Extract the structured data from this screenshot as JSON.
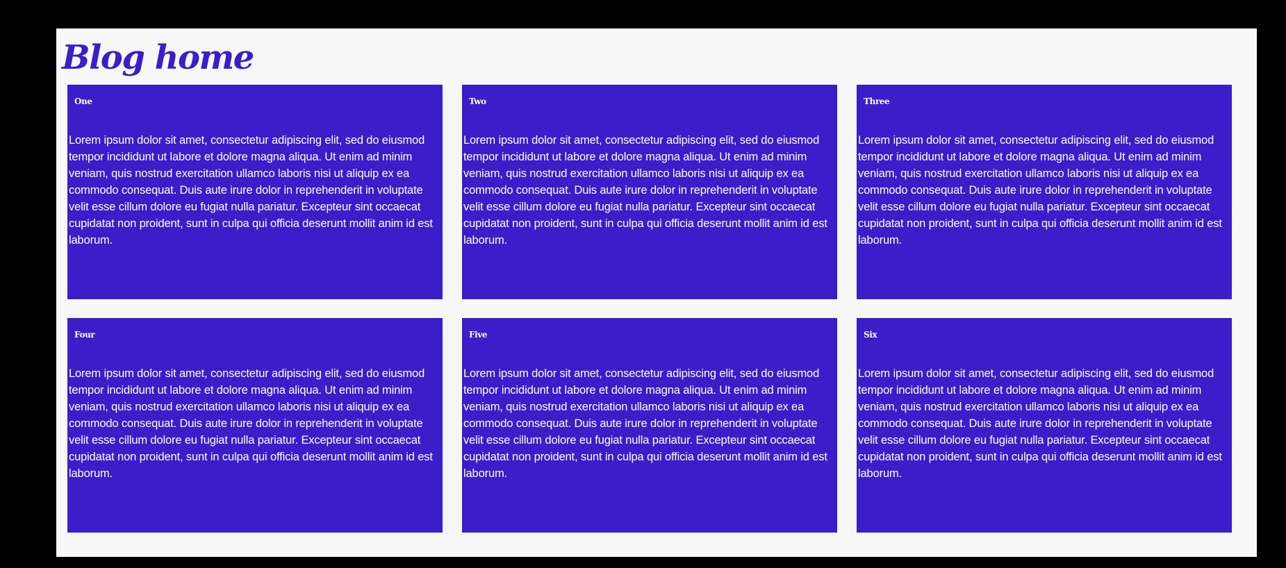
{
  "page": {
    "title": "Blog home"
  },
  "cards": [
    {
      "title": "One",
      "body": "Lorem ipsum dolor sit amet, consectetur adipiscing elit, sed do eiusmod tempor incididunt ut labore et dolore magna aliqua. Ut enim ad minim veniam, quis nostrud exercitation ullamco laboris nisi ut aliquip ex ea commodo consequat. Duis aute irure dolor in reprehenderit in voluptate velit esse cillum dolore eu fugiat nulla pariatur. Excepteur sint occaecat cupidatat non proident, sunt in culpa qui officia deserunt mollit anim id est laborum."
    },
    {
      "title": "Two",
      "body": "Lorem ipsum dolor sit amet, consectetur adipiscing elit, sed do eiusmod tempor incididunt ut labore et dolore magna aliqua. Ut enim ad minim veniam, quis nostrud exercitation ullamco laboris nisi ut aliquip ex ea commodo consequat. Duis aute irure dolor in reprehenderit in voluptate velit esse cillum dolore eu fugiat nulla pariatur. Excepteur sint occaecat cupidatat non proident, sunt in culpa qui officia deserunt mollit anim id est laborum."
    },
    {
      "title": "Three",
      "body": "Lorem ipsum dolor sit amet, consectetur adipiscing elit, sed do eiusmod tempor incididunt ut labore et dolore magna aliqua. Ut enim ad minim veniam, quis nostrud exercitation ullamco laboris nisi ut aliquip ex ea commodo consequat. Duis aute irure dolor in reprehenderit in voluptate velit esse cillum dolore eu fugiat nulla pariatur. Excepteur sint occaecat cupidatat non proident, sunt in culpa qui officia deserunt mollit anim id est laborum."
    },
    {
      "title": "Four",
      "body": "Lorem ipsum dolor sit amet, consectetur adipiscing elit, sed do eiusmod tempor incididunt ut labore et dolore magna aliqua. Ut enim ad minim veniam, quis nostrud exercitation ullamco laboris nisi ut aliquip ex ea commodo consequat. Duis aute irure dolor in reprehenderit in voluptate velit esse cillum dolore eu fugiat nulla pariatur. Excepteur sint occaecat cupidatat non proident, sunt in culpa qui officia deserunt mollit anim id est laborum."
    },
    {
      "title": "Five",
      "body": "Lorem ipsum dolor sit amet, consectetur adipiscing elit, sed do eiusmod tempor incididunt ut labore et dolore magna aliqua. Ut enim ad minim veniam, quis nostrud exercitation ullamco laboris nisi ut aliquip ex ea commodo consequat. Duis aute irure dolor in reprehenderit in voluptate velit esse cillum dolore eu fugiat nulla pariatur. Excepteur sint occaecat cupidatat non proident, sunt in culpa qui officia deserunt mollit anim id est laborum."
    },
    {
      "title": "Six",
      "body": "Lorem ipsum dolor sit amet, consectetur adipiscing elit, sed do eiusmod tempor incididunt ut labore et dolore magna aliqua. Ut enim ad minim veniam, quis nostrud exercitation ullamco laboris nisi ut aliquip ex ea commodo consequat. Duis aute irure dolor in reprehenderit in voluptate velit esse cillum dolore eu fugiat nulla pariatur. Excepteur sint occaecat cupidatat non proident, sunt in culpa qui officia deserunt mollit anim id est laborum."
    }
  ],
  "colors": {
    "window_background": "#000000",
    "page_background": "#f7f7f7",
    "accent": "#3b1dc9",
    "card_text": "#ffffff"
  }
}
